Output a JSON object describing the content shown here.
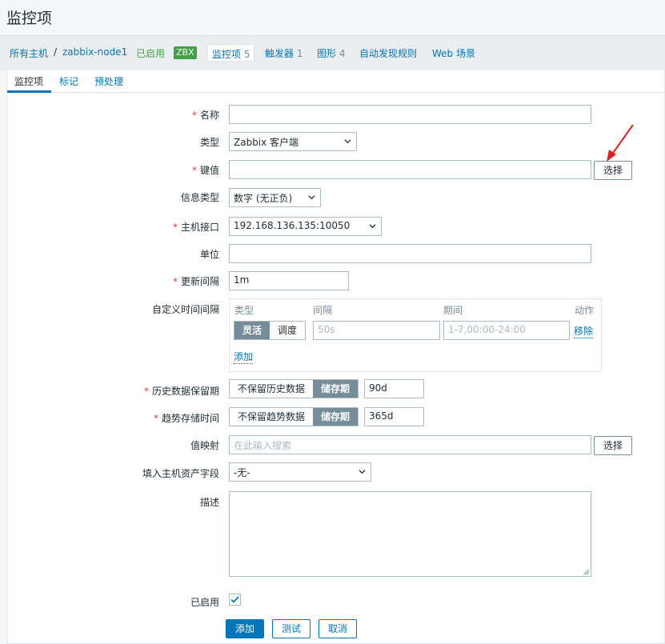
{
  "page": {
    "title": "监控项"
  },
  "breadcrumb": {
    "all_hosts": "所有主机",
    "sep": "/",
    "host": "zabbix-node1",
    "enabled": "已启用",
    "zbx": "ZBX",
    "items": "监控项",
    "items_count": "5",
    "triggers": "触发器",
    "triggers_count": "1",
    "graphs": "图形",
    "graphs_count": "4",
    "discovery": "自动发现规则",
    "web": "Web 场景"
  },
  "tabs": [
    "监控项",
    "标记",
    "预处理"
  ],
  "form": {
    "name": {
      "label": "名称",
      "value": ""
    },
    "type": {
      "label": "类型",
      "value": "Zabbix 客户端"
    },
    "key": {
      "label": "键值",
      "value": "",
      "select_label": "选择"
    },
    "value_type": {
      "label": "信息类型",
      "value": "数字 (无正负)"
    },
    "interface": {
      "label": "主机接口",
      "value": "192.168.136.135:10050"
    },
    "units": {
      "label": "单位",
      "value": ""
    },
    "delay": {
      "label": "更新间隔",
      "value": "1m"
    },
    "custom_intervals": {
      "label": "自定义时间间隔",
      "col_type": "类型",
      "col_interval": "间隔",
      "col_period": "期间",
      "col_action": "动作",
      "opt_flexible": "灵活",
      "opt_scheduling": "调度",
      "interval_placeholder": "50s",
      "period_placeholder": "1-7,00:00-24:00",
      "remove": "移除",
      "add": "添加"
    },
    "history": {
      "label": "历史数据保留期",
      "opt_off": "不保留历史数据",
      "opt_on": "储存期",
      "value": "90d"
    },
    "trends": {
      "label": "趋势存储时间",
      "opt_off": "不保留趋势数据",
      "opt_on": "储存期",
      "value": "365d"
    },
    "valuemap": {
      "label": "值映射",
      "placeholder": "在此输入搜索",
      "select_label": "选择"
    },
    "inventory": {
      "label": "填入主机资产字段",
      "value": "-无-"
    },
    "description": {
      "label": "描述",
      "value": ""
    },
    "enabled": {
      "label": "已启用",
      "checked": true
    }
  },
  "actions": {
    "add": "添加",
    "test": "测试",
    "cancel": "取消"
  },
  "required_mark": "*",
  "colors": {
    "accent": "#0275b8",
    "enabled": "#429e47",
    "required": "#e33734",
    "annotation_arrow": "#e02020"
  }
}
